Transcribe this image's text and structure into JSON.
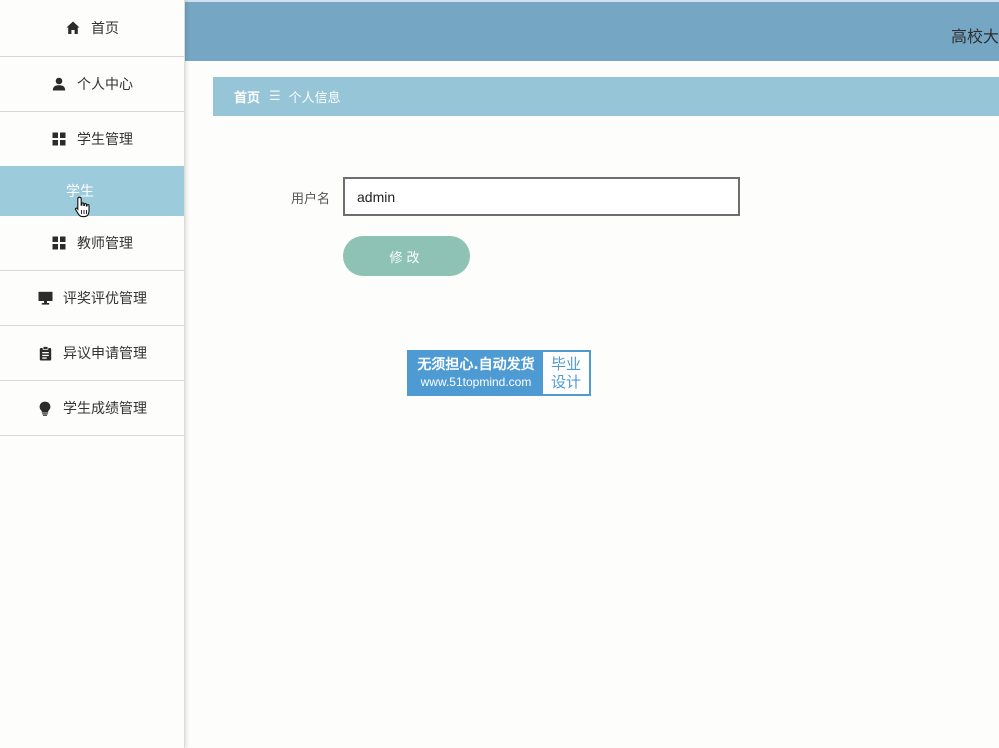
{
  "sidebar": {
    "items": [
      {
        "label": "首页",
        "icon": "home-icon"
      },
      {
        "label": "个人中心",
        "icon": "person-icon"
      },
      {
        "label": "学生管理",
        "icon": "grid-icon"
      },
      {
        "label": "教师管理",
        "icon": "grid-icon"
      },
      {
        "label": "评奖评优管理",
        "icon": "monitor-icon"
      },
      {
        "label": "异议申请管理",
        "icon": "clipboard-icon"
      },
      {
        "label": "学生成绩管理",
        "icon": "bulb-icon"
      }
    ],
    "sub_item": {
      "label": "学生"
    }
  },
  "header": {
    "title": "高校大"
  },
  "breadcrumb": {
    "home": "首页",
    "separator": "☰",
    "current": "个人信息"
  },
  "form": {
    "username_label": "用户名",
    "username_value": "admin",
    "submit_label": "修改"
  },
  "watermark": {
    "line1": "无须担心.自动发货",
    "line2": "www.51topmind.com",
    "right_line1": "毕业",
    "right_line2": "设计"
  },
  "colors": {
    "topbar": "#75a7c4",
    "breadcrumb": "#95c5d6",
    "sidebar_active": "#9ccbdc",
    "button": "#8ec2b4"
  }
}
